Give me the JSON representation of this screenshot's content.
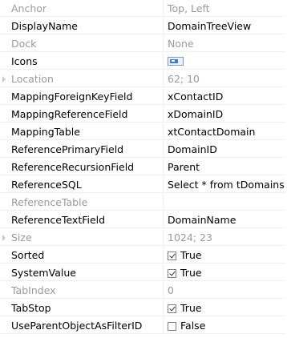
{
  "properties": [
    {
      "name": "Anchor",
      "value": "Top, Left",
      "dim": true
    },
    {
      "name": "DisplayName",
      "value": "DomainTreeView"
    },
    {
      "name": "Dock",
      "value": "None",
      "dim": true
    },
    {
      "name": "Icons",
      "value": "",
      "icon": "icon-list-preview-icon"
    },
    {
      "name": "Location",
      "value": "62; 10",
      "dim": true,
      "expandable": true
    },
    {
      "name": "MappingForeignKeyField",
      "value": "xContactID"
    },
    {
      "name": "MappingReferenceField",
      "value": "xDomainID"
    },
    {
      "name": "MappingTable",
      "value": "xtContactDomain"
    },
    {
      "name": "ReferencePrimaryField",
      "value": "DomainID"
    },
    {
      "name": "ReferenceRecursionField",
      "value": "Parent"
    },
    {
      "name": "ReferenceSQL",
      "value": "Select * from tDomains"
    },
    {
      "name": "ReferenceTable",
      "value": "",
      "dim": true
    },
    {
      "name": "ReferenceTextField",
      "value": "DomainName"
    },
    {
      "name": "Size",
      "value": "1024; 23",
      "dim": true,
      "expandable": true
    },
    {
      "name": "Sorted",
      "value": "True",
      "checkbox": true,
      "checked": true
    },
    {
      "name": "SystemValue",
      "value": "True",
      "checkbox": true,
      "checked": true
    },
    {
      "name": "TabIndex",
      "value": "0",
      "dim": true
    },
    {
      "name": "TabStop",
      "value": "True",
      "checkbox": true,
      "checked": true
    },
    {
      "name": "UseParentObjectAsFilterID",
      "value": "False",
      "checkbox": true,
      "checked": false
    }
  ],
  "colors": {
    "dim_text": "#9a9a9a",
    "grid_line": "#f0f0f0"
  }
}
